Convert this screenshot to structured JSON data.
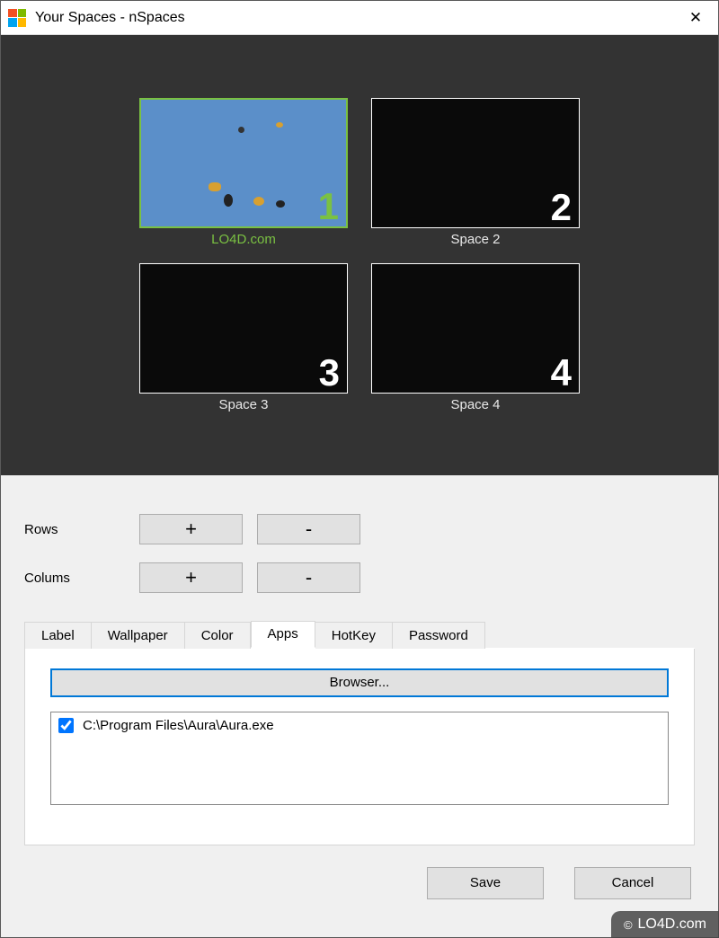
{
  "window": {
    "title": "Your Spaces - nSpaces"
  },
  "spaces": [
    {
      "num": "1",
      "label": "LO4D.com",
      "active": true
    },
    {
      "num": "2",
      "label": "Space 2",
      "active": false
    },
    {
      "num": "3",
      "label": "Space 3",
      "active": false
    },
    {
      "num": "4",
      "label": "Space 4",
      "active": false
    }
  ],
  "controls": {
    "rows_label": "Rows",
    "cols_label": "Colums",
    "plus": "+",
    "minus": "-"
  },
  "tabs": [
    {
      "label": "Label",
      "active": false
    },
    {
      "label": "Wallpaper",
      "active": false
    },
    {
      "label": "Color",
      "active": false
    },
    {
      "label": "Apps",
      "active": true
    },
    {
      "label": "HotKey",
      "active": false
    },
    {
      "label": "Password",
      "active": false
    }
  ],
  "apps_tab": {
    "browser_button": "Browser...",
    "items": [
      {
        "checked": true,
        "path": "C:\\Program Files\\Aura\\Aura.exe"
      }
    ]
  },
  "footer": {
    "save": "Save",
    "cancel": "Cancel"
  },
  "watermark": "LO4D.com"
}
